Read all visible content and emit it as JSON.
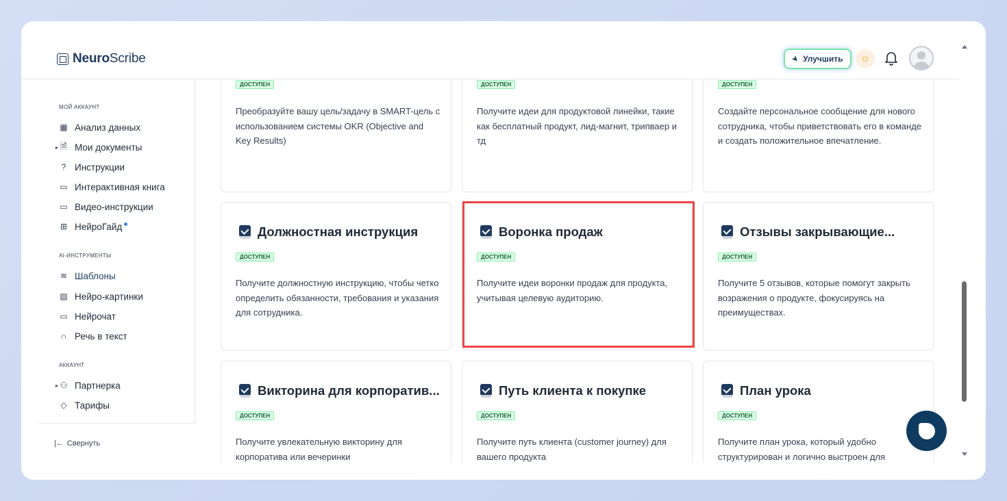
{
  "header": {
    "logo_bold": "Neuro",
    "logo_rest": "Scribe",
    "upgrade_label": "Улучшить"
  },
  "sidebar": {
    "sections": [
      {
        "title": "МОЙ АККАУНТ",
        "items": [
          {
            "label": "Анализ данных",
            "icon": "grid-icon"
          },
          {
            "label": "Мои документы",
            "icon": "document-icon",
            "expandable": true
          },
          {
            "label": "Инструкции",
            "icon": "help-circle-icon"
          },
          {
            "label": "Интерактивная книга",
            "icon": "book-icon"
          },
          {
            "label": "Видео-инструкции",
            "icon": "video-icon"
          },
          {
            "label": "НейроГайд",
            "icon": "guide-icon",
            "new_dot": true
          }
        ]
      },
      {
        "title": "AI-ИНСТРУМЕНТЫ",
        "items": [
          {
            "label": "Шаблоны",
            "icon": "layers-icon",
            "active": true
          },
          {
            "label": "Нейро-картинки",
            "icon": "image-icon"
          },
          {
            "label": "Нейрочат",
            "icon": "chat-icon"
          },
          {
            "label": "Речь в текст",
            "icon": "headphones-icon"
          }
        ]
      },
      {
        "title": "АККАУНТ",
        "items": [
          {
            "label": "Партнерка",
            "icon": "users-icon",
            "expandable": true
          },
          {
            "label": "Тарифы",
            "icon": "tag-icon"
          }
        ]
      }
    ],
    "collapse_label": "Свернуть"
  },
  "cards_top": [
    {
      "badge": "ДОСТУПЕН",
      "description": "Преобразуйте вашу цель/задачу в SMART-цель с использованием системы OKR (Objective and Key Results)"
    },
    {
      "badge": "ДОСТУПЕН",
      "description": "Получите идеи для продуктовой линейки, такие как бесплатный продукт, лид-магнит, трипваер и тд"
    },
    {
      "badge": "ДОСТУПЕН",
      "description": "Создайте персональное сообщение для нового сотрудника, чтобы приветствовать его в команде и создать положительное впечатление."
    }
  ],
  "cards_middle": [
    {
      "title": "Должностная инструкция",
      "badge": "ДОСТУПЕН",
      "description": "Получите должностную инструкцию, чтобы четко определить обязанности, требования и указания для сотрудника."
    },
    {
      "title": "Воронка продаж",
      "badge": "ДОСТУПЕН",
      "description": "Получите идеи воронки продаж для продукта, учитывая целевую аудиторию.",
      "highlighted": true
    },
    {
      "title": "Отзывы закрывающие...",
      "badge": "ДОСТУПЕН",
      "description": "Получите 5 отзывов, которые помогут закрыть возражения о продукте, фокусируясь на преимуществах."
    }
  ],
  "cards_bottom": [
    {
      "title": "Викторина для корпоратив...",
      "badge": "ДОСТУПЕН",
      "description": "Получите увлекательную викторину для корпоратива или вечеринки"
    },
    {
      "title": "Путь клиента к покупке",
      "badge": "ДОСТУПЕН",
      "description": "Получите путь клиента (customer journey) для вашего продукта"
    },
    {
      "title": "План урока",
      "badge": "ДОСТУПЕН",
      "description": "Получите план урока, который удобно структурирован и логично выстроен для"
    }
  ],
  "colors": {
    "brand": "#1e3a5f",
    "badge_bg": "#dcfce7",
    "highlight": "#ef4444",
    "fab": "#0f3b60"
  }
}
